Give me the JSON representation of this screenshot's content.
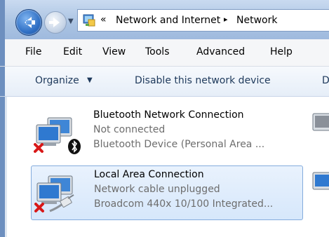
{
  "address": {
    "overflow_chevron": "«",
    "crumbs": [
      "Network and Internet",
      "Network"
    ],
    "separator": "▸"
  },
  "menu": {
    "items": [
      "File",
      "Edit",
      "View",
      "Tools",
      "Advanced",
      "Help"
    ]
  },
  "toolbar": {
    "organize": "Organize",
    "organize_arrow": "▼",
    "disable": "Disable this network device",
    "cut_label": "D"
  },
  "connections": [
    {
      "name": "Bluetooth Network Connection",
      "status": "Not connected",
      "device": "Bluetooth Device (Personal Area ...",
      "overlay_icon": "bluetooth-icon",
      "error_icon": "red-x-icon",
      "selected": false
    },
    {
      "name": "Local Area Connection",
      "status": "Network cable unplugged",
      "device": "Broadcom 440x 10/100 Integrated...",
      "overlay_icon": "network-cable-icon",
      "error_icon": "red-x-icon",
      "selected": true
    }
  ],
  "colors": {
    "titlebar": "#aac3e2",
    "selection_border": "#84acdd",
    "selection_fill": "#d6e7fb",
    "secondary_text": "#6d6d6d",
    "toolbar_text": "#1e395b"
  }
}
